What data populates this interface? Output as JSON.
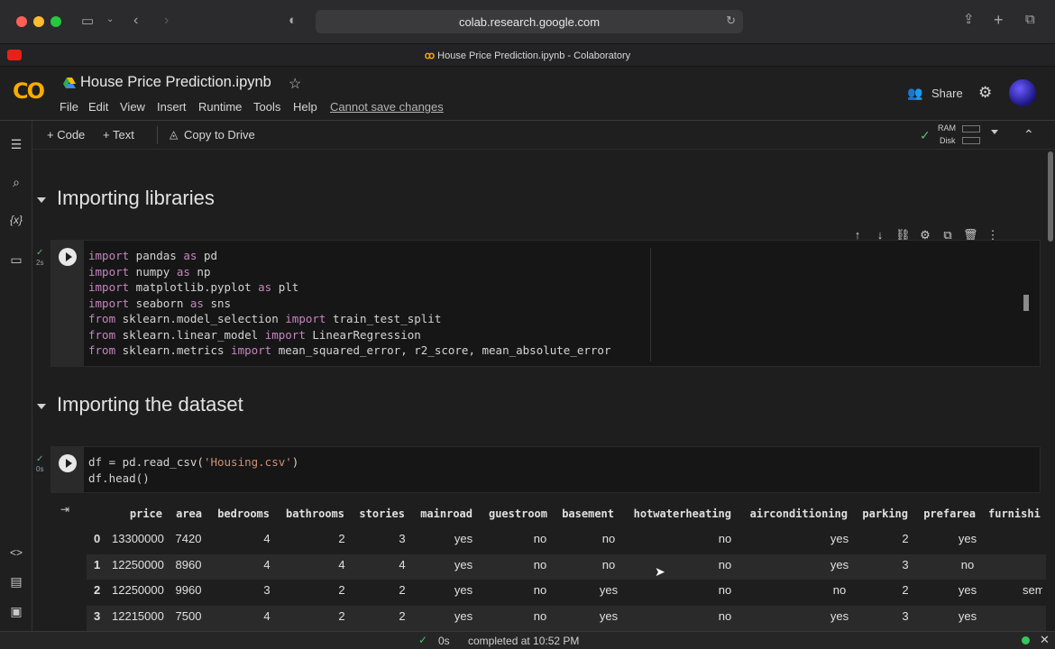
{
  "browser": {
    "url": "colab.research.google.com",
    "tab_title": "House Price Prediction.ipynb - Colaboratory"
  },
  "header": {
    "logo": "CO",
    "doc_title": "House Price Prediction.ipynb",
    "menu": [
      "File",
      "Edit",
      "View",
      "Insert",
      "Runtime",
      "Tools",
      "Help"
    ],
    "cannot_save": "Cannot save changes",
    "share_label": "Share"
  },
  "toolbar": {
    "code_label": "+ Code",
    "text_label": "+ Text",
    "copy_label": "Copy to Drive",
    "ram_label": "RAM",
    "disk_label": "Disk"
  },
  "sections": {
    "importing_libraries": "Importing libraries",
    "importing_dataset": "Importing the dataset"
  },
  "cell1": {
    "exec_time": "2s",
    "lines": [
      [
        "import",
        " pandas ",
        "as",
        " pd"
      ],
      [
        "import",
        " numpy ",
        "as",
        " np"
      ],
      [
        "import",
        " matplotlib.pyplot ",
        "as",
        " plt"
      ],
      [
        "import",
        " seaborn ",
        "as",
        " sns"
      ],
      [
        "from",
        " sklearn.model_selection ",
        "import",
        " train_test_split"
      ],
      [
        "from",
        " sklearn.linear_model ",
        "import",
        " LinearRegression"
      ],
      [
        "from",
        " sklearn.metrics ",
        "import",
        " mean_squared_error, r2_score, mean_absolute_error"
      ]
    ]
  },
  "cell2": {
    "exec_time": "0s",
    "line1_a": "df = pd.read_csv(",
    "line1_b": "'Housing.csv'",
    "line1_c": ")",
    "line2": "df.head()"
  },
  "table": {
    "columns": [
      "price",
      "area",
      "bedrooms",
      "bathrooms",
      "stories",
      "mainroad",
      "guestroom",
      "basement",
      "hotwaterheating",
      "airconditioning",
      "parking",
      "prefarea",
      "furnishi"
    ],
    "rows": [
      [
        "0",
        "13300000",
        "7420",
        "4",
        "2",
        "3",
        "yes",
        "no",
        "no",
        "no",
        "yes",
        "2",
        "yes",
        ""
      ],
      [
        "1",
        "12250000",
        "8960",
        "4",
        "4",
        "4",
        "yes",
        "no",
        "no",
        "no",
        "yes",
        "3",
        "no",
        ""
      ],
      [
        "2",
        "12250000",
        "9960",
        "3",
        "2",
        "2",
        "yes",
        "no",
        "yes",
        "no",
        "no",
        "2",
        "yes",
        "sem"
      ],
      [
        "3",
        "12215000",
        "7500",
        "4",
        "2",
        "2",
        "yes",
        "no",
        "yes",
        "no",
        "yes",
        "3",
        "yes",
        ""
      ]
    ]
  },
  "status": {
    "duration": "0s",
    "completed": "completed at 10:52 PM"
  }
}
